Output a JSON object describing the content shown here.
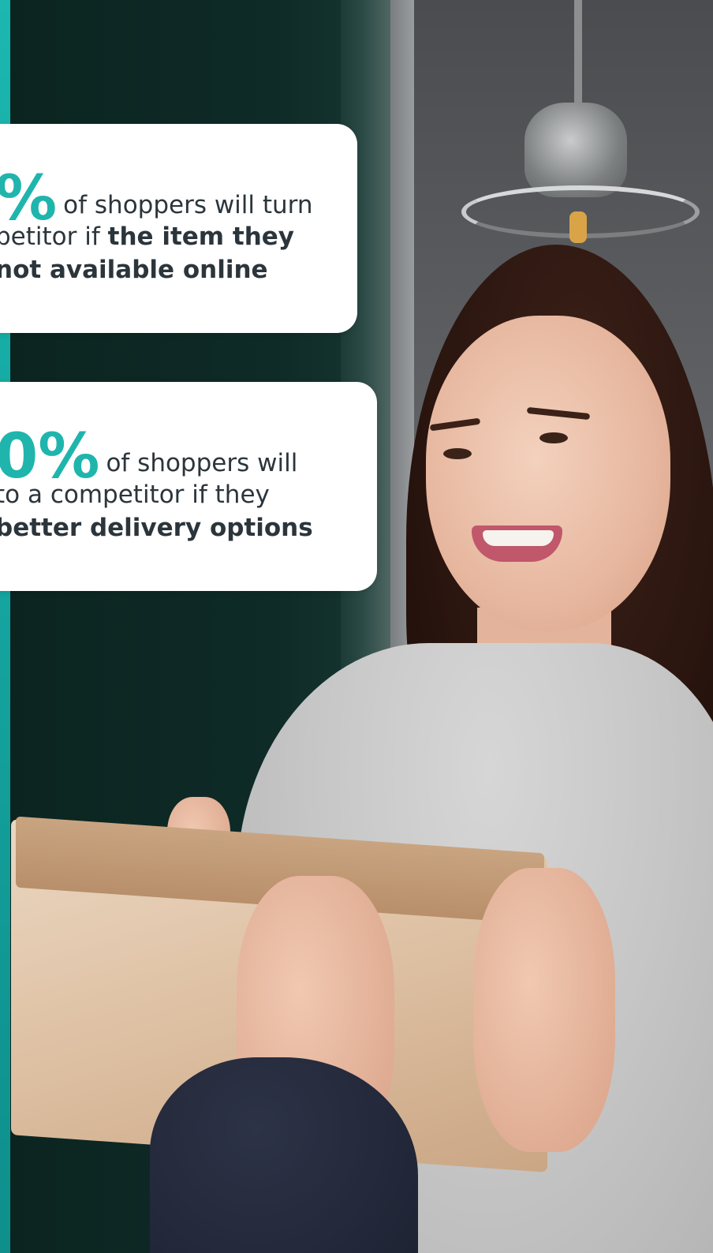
{
  "stats": [
    {
      "figure": "%",
      "line1_rest": "of shoppers will turn",
      "line2_plain": "petitor if ",
      "line2_bold": "the item they",
      "line3_bold": "not available online"
    },
    {
      "figure": "0%",
      "line1_rest": "of shoppers will",
      "line2_plain": "to a competitor if they",
      "line3_bold": "better delivery options"
    }
  ],
  "colors": {
    "accent_teal": "#1fb5ad",
    "text_dark": "#2b353b",
    "card_bg": "#ffffff"
  }
}
